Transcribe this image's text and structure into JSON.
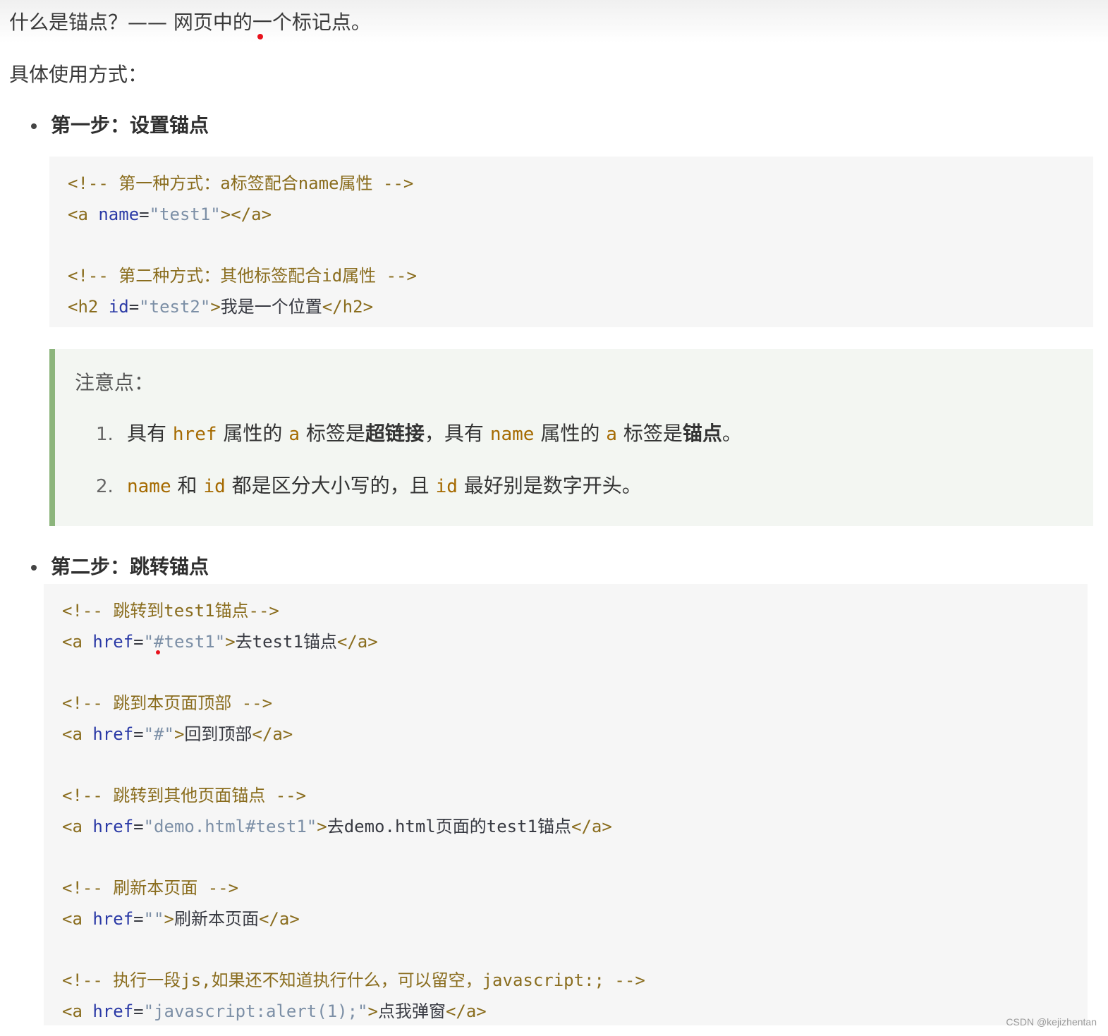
{
  "intro": {
    "text": "什么是锚点？—— 网页中的一个标记点。",
    "usage": "具体使用方式："
  },
  "step1": {
    "title": "第一步：设置锚点",
    "code": {
      "l1": "<!-- 第一种方式：a标签配合name属性 -->",
      "l2_open": "<a",
      "l2_attr": "name",
      "l2_eq": "=",
      "l2_val": "\"test1\"",
      "l2_close": "></a>",
      "l3": "<!-- 第二种方式：其他标签配合id属性 -->",
      "l4_open": "<h2",
      "l4_attr": "id",
      "l4_eq": "=",
      "l4_val": "\"test2\"",
      "l4_gt": ">",
      "l4_text": "我是一个位置",
      "l4_close": "</h2>"
    }
  },
  "note": {
    "title": "注意点：",
    "item1": {
      "num": "1.",
      "t1": "具有 ",
      "c1": "href",
      "t2": " 属性的 ",
      "c2": "a",
      "t3": " 标签是",
      "b1": "超链接",
      "t4": "，具有 ",
      "c3": "name",
      "t5": " 属性的 ",
      "c4": "a",
      "t6": " 标签是",
      "b2": "锚点",
      "t7": "。"
    },
    "item2": {
      "num": "2.",
      "c1": "name",
      "t1": " 和 ",
      "c2": "id",
      "t2": " 都是区分大小写的，且 ",
      "c3": "id",
      "t3": " 最好别是数字开头。"
    }
  },
  "step2": {
    "title": "第二步：跳转锚点",
    "code": {
      "c1": "<!-- 跳转到test1锚点-->",
      "a1_val": "\"#test1\"",
      "a1_text": "去test1锚点",
      "c2": "<!-- 跳到本页面顶部 -->",
      "a2_val": "\"#\"",
      "a2_text": "回到顶部",
      "c3": "<!-- 跳转到其他页面锚点 -->",
      "a3_val": "\"demo.html#test1\"",
      "a3_text": "去demo.html页面的test1锚点",
      "c4": "<!-- 刷新本页面 -->",
      "a4_val": "\"\"",
      "a4_text": "刷新本页面",
      "c5": "<!-- 执行一段js,如果还不知道执行什么，可以留空，javascript:; -->",
      "a5_val": "\"javascript:alert(1);\"",
      "a5_text": "点我弹窗",
      "open": "<a",
      "attr": "href",
      "eq": "=",
      "gt": ">",
      "close": "</a>"
    }
  },
  "watermark": "CSDN @kejizhentan",
  "colors": {
    "comment": "#8a6d1e",
    "attr": "#2b3aa6",
    "string": "#7c8fa6",
    "inline_code": "#a56a00",
    "callout_border": "#8cb57c"
  }
}
